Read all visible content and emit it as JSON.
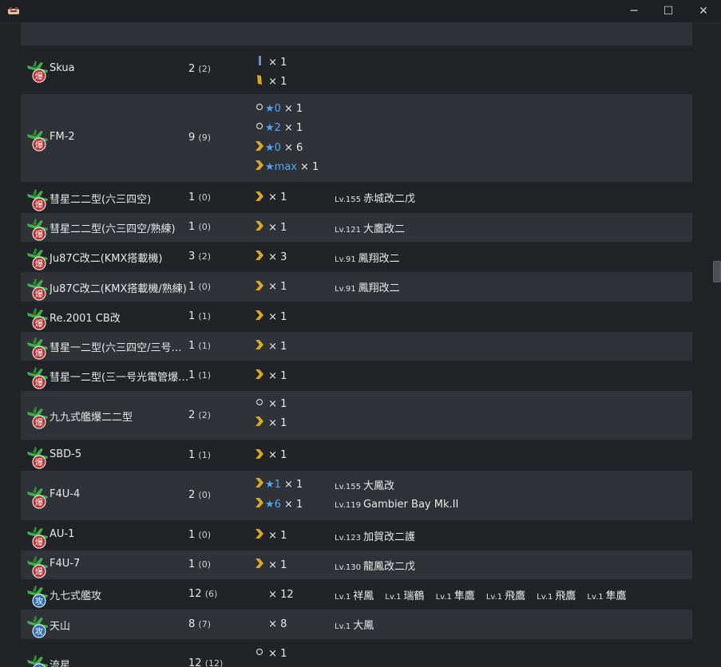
{
  "window": {
    "minimize_glyph": "─",
    "maximize_glyph": "☐",
    "close_glyph": "✕"
  },
  "colors": {
    "background": "#212326",
    "row_alt": "#2f3237",
    "star": "#4fa8ff",
    "chevron": "#d9a82b"
  },
  "rows": [
    {
      "name": "",
      "count": "",
      "sub": "",
      "alt": true,
      "improvements": [
        {
          "icon": "chevron",
          "star": "",
          "qty": ""
        }
      ],
      "ships": []
    },
    {
      "name": "Skua",
      "count": "2",
      "sub": "(2)",
      "alt": false,
      "improvements": [
        {
          "icon": "bar-blue",
          "star": "",
          "qty": "× 1"
        },
        {
          "icon": "bar-gold",
          "star": "",
          "qty": "× 1"
        }
      ],
      "ships": []
    },
    {
      "name": "FM-2",
      "count": "9",
      "sub": "(9)",
      "alt": true,
      "improvements": [
        {
          "icon": "circle",
          "star": "★0",
          "qty": "× 1"
        },
        {
          "icon": "circle",
          "star": "★2",
          "qty": "× 1"
        },
        {
          "icon": "chevron",
          "star": "★0",
          "qty": "× 6"
        },
        {
          "icon": "chevron",
          "star": "★max",
          "qty": "× 1"
        }
      ],
      "ships": []
    },
    {
      "name": "彗星二二型(六三四空)",
      "count": "1",
      "sub": "(0)",
      "alt": false,
      "improvements": [
        {
          "icon": "chevron",
          "star": "",
          "qty": "× 1"
        }
      ],
      "ships": [
        {
          "lv": "Lv.155",
          "name": "赤城改二戊"
        }
      ]
    },
    {
      "name": "彗星二二型(六三四空/熟練)",
      "count": "1",
      "sub": "(0)",
      "alt": true,
      "improvements": [
        {
          "icon": "chevron",
          "star": "",
          "qty": "× 1"
        }
      ],
      "ships": [
        {
          "lv": "Lv.121",
          "name": "大鷹改二"
        }
      ]
    },
    {
      "name": "Ju87C改二(KMX搭載機)",
      "count": "3",
      "sub": "(2)",
      "alt": false,
      "improvements": [
        {
          "icon": "chevron",
          "star": "",
          "qty": "× 3"
        }
      ],
      "ships": [
        {
          "lv": "Lv.91",
          "name": "鳳翔改二"
        }
      ]
    },
    {
      "name": "Ju87C改二(KMX搭載機/熟練)",
      "count": "1",
      "sub": "(0)",
      "alt": true,
      "improvements": [
        {
          "icon": "chevron",
          "star": "",
          "qty": "× 1"
        }
      ],
      "ships": [
        {
          "lv": "Lv.91",
          "name": "鳳翔改二"
        }
      ]
    },
    {
      "name": "Re.2001 CB改",
      "count": "1",
      "sub": "(1)",
      "alt": false,
      "improvements": [
        {
          "icon": "chevron",
          "star": "",
          "qty": "× 1"
        }
      ],
      "ships": []
    },
    {
      "name": "彗星一二型(六三四空/三号…",
      "count": "1",
      "sub": "(1)",
      "alt": true,
      "improvements": [
        {
          "icon": "chevron",
          "star": "",
          "qty": "× 1"
        }
      ],
      "ships": []
    },
    {
      "name": "彗星一二型(三一号光電管爆…",
      "count": "1",
      "sub": "(1)",
      "alt": false,
      "improvements": [
        {
          "icon": "chevron",
          "star": "",
          "qty": "× 1"
        }
      ],
      "ships": []
    },
    {
      "name": "九九式艦爆二二型",
      "count": "2",
      "sub": "(2)",
      "alt": true,
      "improvements": [
        {
          "icon": "circle",
          "star": "",
          "qty": "× 1"
        },
        {
          "icon": "chevron",
          "star": "",
          "qty": "× 1"
        }
      ],
      "ships": []
    },
    {
      "name": "SBD-5",
      "count": "1",
      "sub": "(1)",
      "alt": false,
      "improvements": [
        {
          "icon": "chevron",
          "star": "",
          "qty": "× 1"
        }
      ],
      "ships": []
    },
    {
      "name": "F4U-4",
      "count": "2",
      "sub": "(0)",
      "alt": true,
      "improvements": [
        {
          "icon": "chevron",
          "star": "★1",
          "qty": "× 1"
        },
        {
          "icon": "chevron",
          "star": "★6",
          "qty": "× 1"
        }
      ],
      "ships": [
        {
          "lv": "Lv.155",
          "name": "大鳳改"
        },
        {
          "lv": "Lv.119",
          "name": "Gambier Bay Mk.II"
        }
      ],
      "ships_stacked": true
    },
    {
      "name": "AU-1",
      "count": "1",
      "sub": "(0)",
      "alt": false,
      "improvements": [
        {
          "icon": "chevron",
          "star": "",
          "qty": "× 1"
        }
      ],
      "ships": [
        {
          "lv": "Lv.123",
          "name": "加賀改二護"
        }
      ]
    },
    {
      "name": "F4U-7",
      "count": "1",
      "sub": "(0)",
      "alt": true,
      "improvements": [
        {
          "icon": "chevron",
          "star": "",
          "qty": "× 1"
        }
      ],
      "ships": [
        {
          "lv": "Lv.130",
          "name": "龍鳳改二戊"
        }
      ]
    },
    {
      "name": "九七式艦攻",
      "count": "12",
      "sub": "(6)",
      "alt": false,
      "torpedo": true,
      "improvements": [
        {
          "icon": "none",
          "star": "",
          "qty": "× 12"
        }
      ],
      "ships": [
        {
          "lv": "Lv.1",
          "name": "祥鳳"
        },
        {
          "lv": "Lv.1",
          "name": "瑞鶴"
        },
        {
          "lv": "Lv.1",
          "name": "隼鷹"
        },
        {
          "lv": "Lv.1",
          "name": "飛鷹"
        },
        {
          "lv": "Lv.1",
          "name": "飛鷹"
        },
        {
          "lv": "Lv.1",
          "name": "隼鷹"
        }
      ]
    },
    {
      "name": "天山",
      "count": "8",
      "sub": "(7)",
      "alt": true,
      "torpedo": true,
      "improvements": [
        {
          "icon": "none",
          "star": "",
          "qty": "× 8"
        }
      ],
      "ships": [
        {
          "lv": "Lv.1",
          "name": "大鳳"
        }
      ]
    },
    {
      "name": "流星",
      "count": "12",
      "sub": "(12)",
      "alt": false,
      "torpedo": true,
      "improvements": [
        {
          "icon": "circle",
          "star": "",
          "qty": "× 1"
        }
      ],
      "ships": []
    }
  ]
}
